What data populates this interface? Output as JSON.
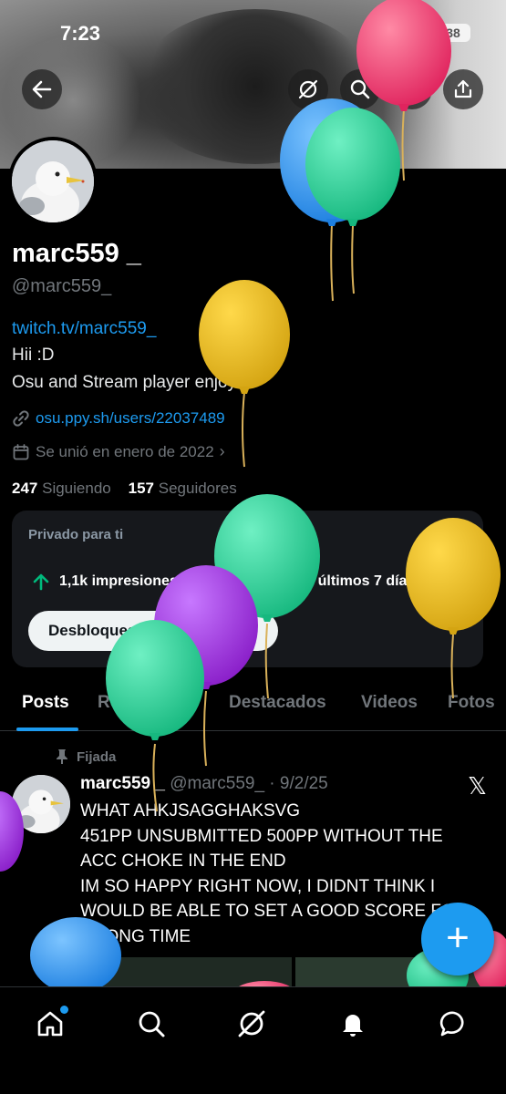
{
  "status_bar": {
    "time": "7:23",
    "battery": "38"
  },
  "profile": {
    "display_name": "marc559 _",
    "handle": "@marc559_",
    "bio_link": "twitch.tv/marc559_",
    "bio_lines": [
      "Hii :D",
      "Osu and Stream player enjoyer"
    ],
    "website": "osu.ppy.sh/users/22037489",
    "joined": "Se unió en enero de 2022",
    "following_count": "247",
    "following_label": "Siguiendo",
    "followers_count": "157",
    "followers_label": "Seguidores"
  },
  "private_card": {
    "title": "Privado para ti",
    "impressions": "1,1k impresiones en tus posts en los últimos 7 días",
    "unlock_label": "Desbloquear estadísticas"
  },
  "tabs": [
    "Posts",
    "Respuestas",
    "Destacados",
    "Videos",
    "Fotos"
  ],
  "post": {
    "pinned_label": "Fijada",
    "author": "marc559 _",
    "meta": "@marc559_ · 9/2/25",
    "lines": [
      "WHAT AHKJSAGGHAKSVG",
      "451PP UNSUBMITTED 500PP WITHOUT THE",
      "ACC CHOKE IN THE END",
      "IM SO HAPPY RIGHT NOW, I DIDNT THINK I",
      "WOULD BE ABLE TO SET A GOOD SCORE FOR",
      "A LONG TIME"
    ]
  },
  "fab_label": "+",
  "icons": {
    "back": "arrow-left-icon",
    "grok": "grok-icon",
    "search": "search-icon",
    "edit": "pencil-icon",
    "share": "share-icon",
    "link": "link-icon",
    "calendar": "calendar-icon",
    "pin": "pin-icon",
    "x_logo": "x-logo-icon",
    "home": "home-icon",
    "bell": "bell-icon",
    "messages": "chat-icon"
  },
  "colors": {
    "accent": "#1d9bf0",
    "background": "#000000",
    "muted": "#71767b"
  }
}
